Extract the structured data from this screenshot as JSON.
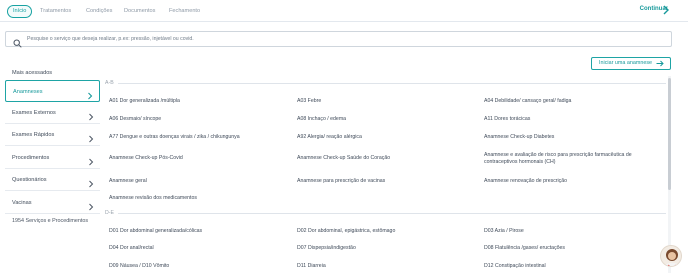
{
  "nav": {
    "tabs": [
      "Início",
      "Tratamentos",
      "Condições",
      "Documentos",
      "Fechamento"
    ],
    "active_tab": "Início",
    "continue_label": "Continuar"
  },
  "search": {
    "placeholder": "Pesquise o serviço que deseja realizar, p.ex: pressão, injetável ou covid."
  },
  "sidebar": {
    "items": [
      "Mais acessados",
      "Anamneses",
      "Exames Externos",
      "Exames Rápidos",
      "Procedimentos",
      "Questionários",
      "Vacinas"
    ],
    "active_item": "Anamneses",
    "count_label": "1954 Serviços e Procedimentos"
  },
  "content": {
    "start_button": "Iniciar uma anamnese",
    "sections": [
      {
        "label": "A-B",
        "rows": [
          [
            "A01 Dor generalizada /múltipla",
            "A03 Febre",
            "A04 Debilidade/ cansaço geral/ fadiga"
          ],
          [
            "A06 Desmaio/ síncope",
            "A08 Inchaço / edema",
            "A11 Dores torácicas"
          ],
          [
            "A77 Dengue e outras doenças virais / zika / chikungunya",
            "A92 Alergia/ reação alérgica",
            "Anamnese Check-up Diabetes"
          ],
          [
            "Anamnese Check-up Pós-Covid",
            "Anamnese Check-up Saúde do Coração",
            "Anamnese e avaliação de risco para prescrição farmacêutica de contraceptivos hormonais (CH)"
          ],
          [
            "Anamnese geral",
            "Anamnese para prescrição de vacinas",
            "Anamnese renovação de prescrição"
          ],
          [
            "Anamnese revisão dos medicamentos",
            "",
            ""
          ]
        ]
      },
      {
        "label": "D-E",
        "rows": [
          [
            "D01 Dor abdominal generalizada/cólicas",
            "D02 Dor abdominal, epigástrica, estômago",
            "D03 Azia / Pirose"
          ],
          [
            "D04 Dor anal/rectal",
            "D07 Dispepsia/indigestão",
            "D08 Flatulência /gases/ eructações"
          ],
          [
            "D09 Náusea / D10 Vômito",
            "D11 Diarreia",
            "D12 Constipação intestinal"
          ]
        ]
      }
    ]
  },
  "colors": {
    "accent": "#17999b",
    "text": "#3f4a59",
    "muted": "#8e99a6"
  }
}
